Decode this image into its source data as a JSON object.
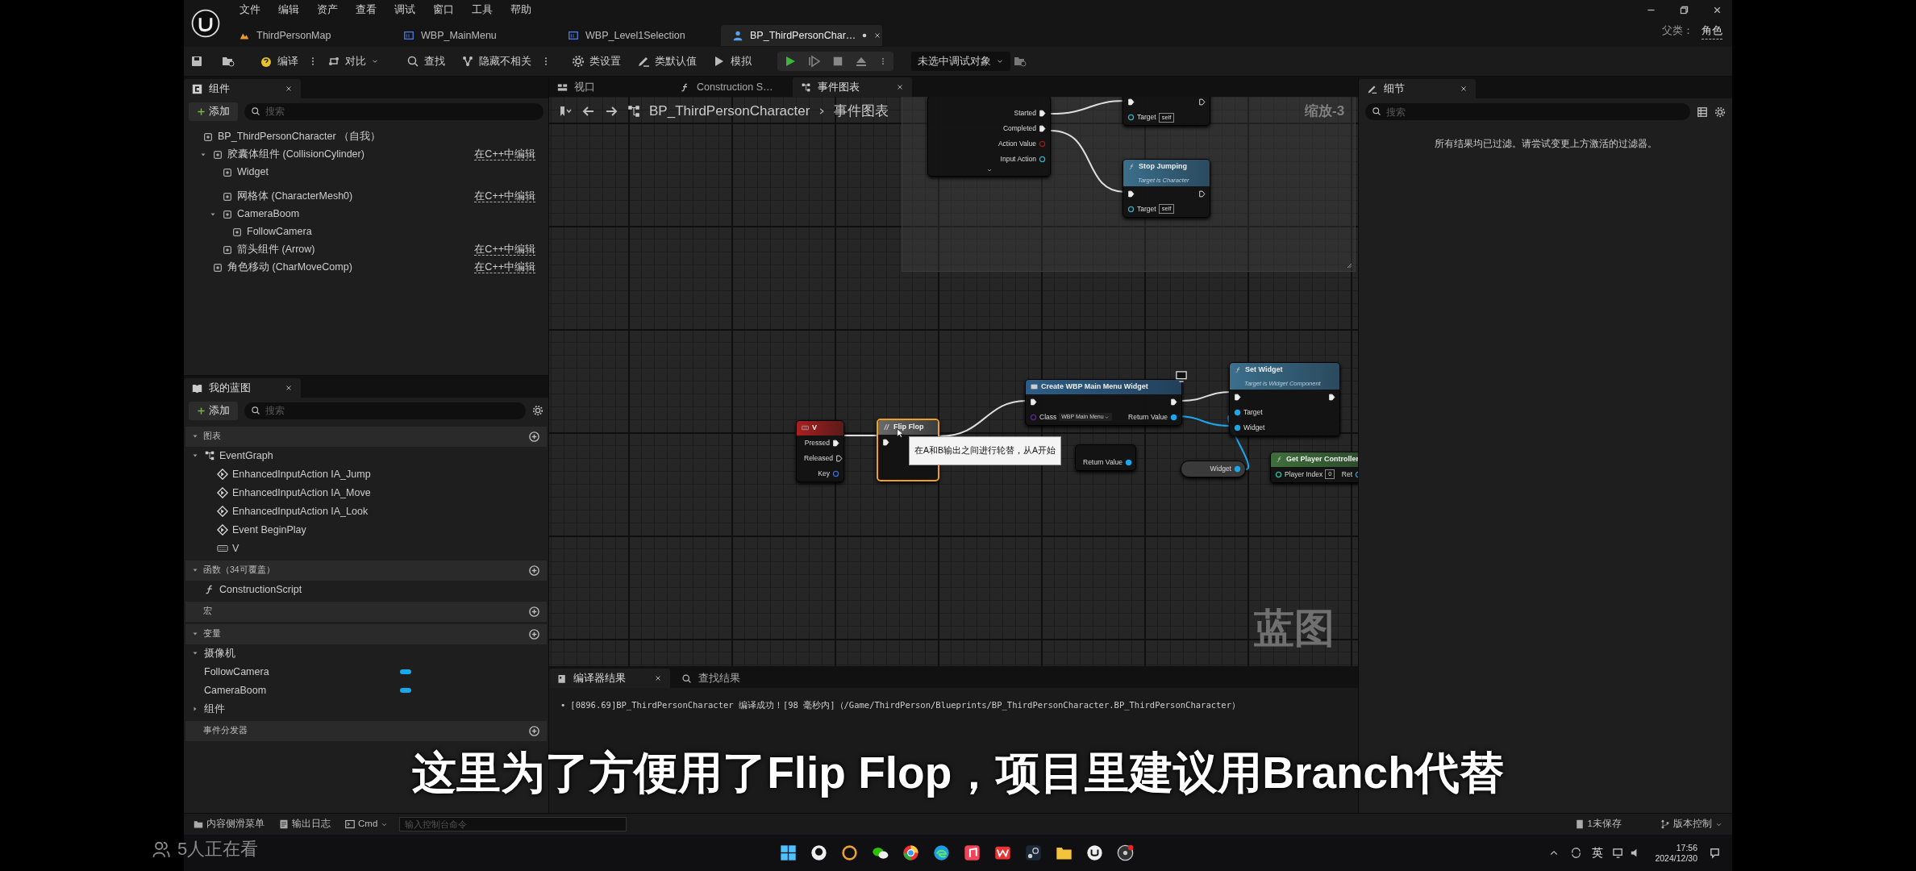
{
  "menu": [
    "文件",
    "编辑",
    "资产",
    "查看",
    "调试",
    "窗口",
    "工具",
    "帮助"
  ],
  "document_tabs": [
    {
      "label": "ThirdPersonMap",
      "kind": "map",
      "selected": false
    },
    {
      "label": "WBP_MainMenu",
      "kind": "widget",
      "selected": false
    },
    {
      "label": "WBP_Level1Selection",
      "kind": "widget",
      "selected": false
    },
    {
      "label": "BP_ThirdPersonChar…",
      "kind": "blueprint",
      "selected": true,
      "unsaved": true
    }
  ],
  "parent_class": {
    "label": "父类：",
    "value": "角色"
  },
  "toolbar": [
    {
      "label": "编译",
      "kind": "compile",
      "more": true
    },
    {
      "label": "对比",
      "kind": "diff",
      "dropdown": true
    },
    {
      "label": "查找",
      "kind": "find"
    },
    {
      "label": "隐藏不相关",
      "kind": "hide",
      "more": true
    },
    {
      "label": "类设置",
      "kind": "settings"
    },
    {
      "label": "类默认值",
      "kind": "defaults"
    },
    {
      "label": "模拟",
      "kind": "simulate"
    }
  ],
  "debug_filter": "未选中调试对象",
  "components_panel": {
    "title": "组件",
    "add": "添加",
    "search_placeholder": "搜索",
    "tree": [
      {
        "label": "BP_ThirdPersonCharacter （自我）",
        "children": [
          {
            "label": "胶囊体组件 (CollisionCylinder)",
            "link": "在C++中编辑",
            "expanded": true,
            "children": [
              {
                "label": "Widget"
              },
              {
                "label": "网格体 (CharacterMesh0)",
                "link": "在C++中编辑"
              },
              {
                "label": "CameraBoom",
                "expanded": true,
                "children": [
                  {
                    "label": "FollowCamera"
                  }
                ]
              },
              {
                "label": "箭头组件 (Arrow)",
                "link": "在C++中编辑"
              }
            ]
          },
          {
            "label": "角色移动 (CharMoveComp)",
            "link": "在C++中编辑"
          }
        ]
      }
    ]
  },
  "my_blueprint": {
    "title": "我的蓝图",
    "add": "添加",
    "search_placeholder": "搜索",
    "sections": [
      {
        "title": "图表",
        "expanded": true,
        "items": [
          {
            "label": "EventGraph",
            "kind": "graph",
            "expanded": true,
            "children": [
              {
                "label": "EnhancedInputAction IA_Jump",
                "kind": "event"
              },
              {
                "label": "EnhancedInputAction IA_Move",
                "kind": "event"
              },
              {
                "label": "EnhancedInputAction IA_Look",
                "kind": "event"
              },
              {
                "label": "Event BeginPlay",
                "kind": "event"
              },
              {
                "label": "V",
                "kind": "key"
              }
            ]
          }
        ]
      },
      {
        "title": "函数（34可覆盖）",
        "expanded": true,
        "items": [
          {
            "label": "ConstructionScript",
            "kind": "function"
          }
        ]
      },
      {
        "title": "宏"
      },
      {
        "title": "变量",
        "expanded": true,
        "items": [
          {
            "label": "摄像机",
            "kind": "category",
            "expanded": true,
            "children": [
              {
                "label": "FollowCamera",
                "kind": "variable",
                "color": "#1aa7ec"
              },
              {
                "label": "CameraBoom",
                "kind": "variable",
                "color": "#1aa7ec"
              }
            ]
          },
          {
            "label": "组件",
            "kind": "category",
            "expanded": false
          }
        ]
      },
      {
        "title": "事件分发器"
      }
    ]
  },
  "graph_tabs": [
    {
      "label": "视口",
      "kind": "viewport",
      "selected": false
    },
    {
      "label": "Construction S…",
      "kind": "function",
      "selected": false
    },
    {
      "label": "事件图表",
      "kind": "graph",
      "selected": true
    }
  ],
  "breadcrumb": [
    "BP_ThirdPersonCharacter",
    "事件图表"
  ],
  "zoom_label": "缩放-3",
  "graph_watermark": "蓝图",
  "nodes": [
    {
      "kind": "input_action",
      "selected": false,
      "rows": [
        {
          "out": {
            "label": "Started",
            "kind": "exec",
            "connected": true
          }
        },
        {
          "out": {
            "label": "Completed",
            "kind": "exec",
            "connected": true
          }
        },
        {
          "out": {
            "label": "Action Value",
            "kind": "data",
            "color": "#a01818",
            "connected": false
          }
        },
        {
          "out": {
            "label": "Input Action",
            "kind": "data",
            "color": "#30b0c8",
            "connected": false
          }
        }
      ]
    },
    {
      "kind": "function",
      "selected": false,
      "rows": [
        {
          "in": {
            "kind": "exec",
            "connected": true
          },
          "out": {
            "kind": "exec",
            "connected": false
          }
        },
        {
          "in": {
            "label": "Target",
            "kind": "data",
            "color": "#30b0c8",
            "value": "self",
            "connected": false
          }
        }
      ]
    },
    {
      "kind": "function",
      "title": "Stop Jumping",
      "subtitle": "Target is Character",
      "selected": false,
      "rows": [
        {
          "in": {
            "kind": "exec",
            "connected": true
          },
          "out": {
            "kind": "exec",
            "connected": false
          }
        },
        {
          "in": {
            "label": "Target",
            "kind": "data",
            "color": "#30b0c8",
            "value": "self",
            "connected": false
          }
        }
      ]
    },
    {
      "kind": "key_event",
      "title": "V",
      "selected": false,
      "rows": [
        {
          "out": {
            "label": "Pressed",
            "kind": "exec",
            "connected": true
          }
        },
        {
          "out": {
            "label": "Released",
            "kind": "exec",
            "connected": false
          }
        },
        {
          "out": {
            "label": "Key",
            "kind": "data",
            "color": "#2a6ee8",
            "connected": false
          }
        }
      ]
    },
    {
      "kind": "flow_control",
      "title": "Flip Flop",
      "selected": true,
      "rows": [
        {
          "in": {
            "kind": "exec",
            "connected": true
          }
        }
      ]
    },
    {
      "kind": "create_widget",
      "title": "Create WBP Main Menu Widget",
      "selected": false,
      "rows": [
        {
          "in": {
            "kind": "exec",
            "connected": true
          },
          "out": {
            "kind": "exec",
            "connected": true
          }
        },
        {
          "in": {
            "label": "Class",
            "kind": "class",
            "color": "#5a2a8c",
            "value": "WBP Main Menu",
            "connected": false
          },
          "out": {
            "label": "Return Value",
            "kind": "data",
            "color": "#1aa7ec",
            "connected": true
          }
        }
      ]
    },
    {
      "kind": "pure_function",
      "selected": false,
      "rows": [
        {
          "out": {
            "label": "Return Value",
            "kind": "data",
            "color": "#1aa7ec",
            "connected": true
          }
        }
      ]
    },
    {
      "kind": "function",
      "title": "Set Widget",
      "subtitle": "Target is Widget Component",
      "selected": false,
      "rows": [
        {
          "in": {
            "kind": "exec",
            "connected": true
          },
          "out": {
            "kind": "exec",
            "connected": true
          }
        },
        {
          "in": {
            "label": "Target",
            "kind": "data",
            "color": "#1aa7ec",
            "connected": true
          }
        },
        {
          "in": {
            "label": "Widget",
            "kind": "data",
            "color": "#1aa7ec",
            "connected": true
          }
        }
      ]
    },
    {
      "kind": "variable",
      "selected": false,
      "rows": [
        {
          "out": {
            "label": "Widget",
            "kind": "data",
            "color": "#1aa7ec",
            "connected": true
          }
        }
      ]
    },
    {
      "kind": "pure_function",
      "title": "Get Player Controller",
      "selected": false,
      "rows": [
        {
          "in": {
            "label": "Player Index",
            "kind": "data",
            "color": "#2ebfa5",
            "value": "0",
            "connected": false
          },
          "out": {
            "label": "Ret",
            "kind": "data",
            "color": "#1aa7ec",
            "connected": false
          }
        }
      ]
    }
  ],
  "tooltip": "在A和B输出之间进行轮替，从A开始",
  "details_panel": {
    "title": "细节",
    "search_placeholder": "搜索",
    "message": "所有结果均已过滤。请尝试变更上方激活的过滤器。"
  },
  "results_tabs": [
    {
      "label": "编译器结果",
      "selected": true
    },
    {
      "label": "查找结果",
      "selected": false
    }
  ],
  "log": [
    {
      "marker": "•",
      "text": "[0896.69]BP_ThirdPersonCharacter 编译成功！[98 毫秒内]（/Game/ThirdPerson/Blueprints/BP_ThirdPersonCharacter.BP_ThirdPersonCharacter）"
    }
  ],
  "status_bar": {
    "content_drawer": "内容侧滑菜单",
    "output_log": "输出日志",
    "cmd": "Cmd",
    "console_placeholder": "输入控制台命令",
    "unsaved": "1未保存",
    "source_control": "版本控制"
  },
  "subtitle": "这里为了方便用了Flip Flop，项目里建议用Branch代替",
  "viewers": "5人正在看",
  "tray": {
    "ime": "英",
    "time": "17:56",
    "date": "2024/12/30"
  }
}
